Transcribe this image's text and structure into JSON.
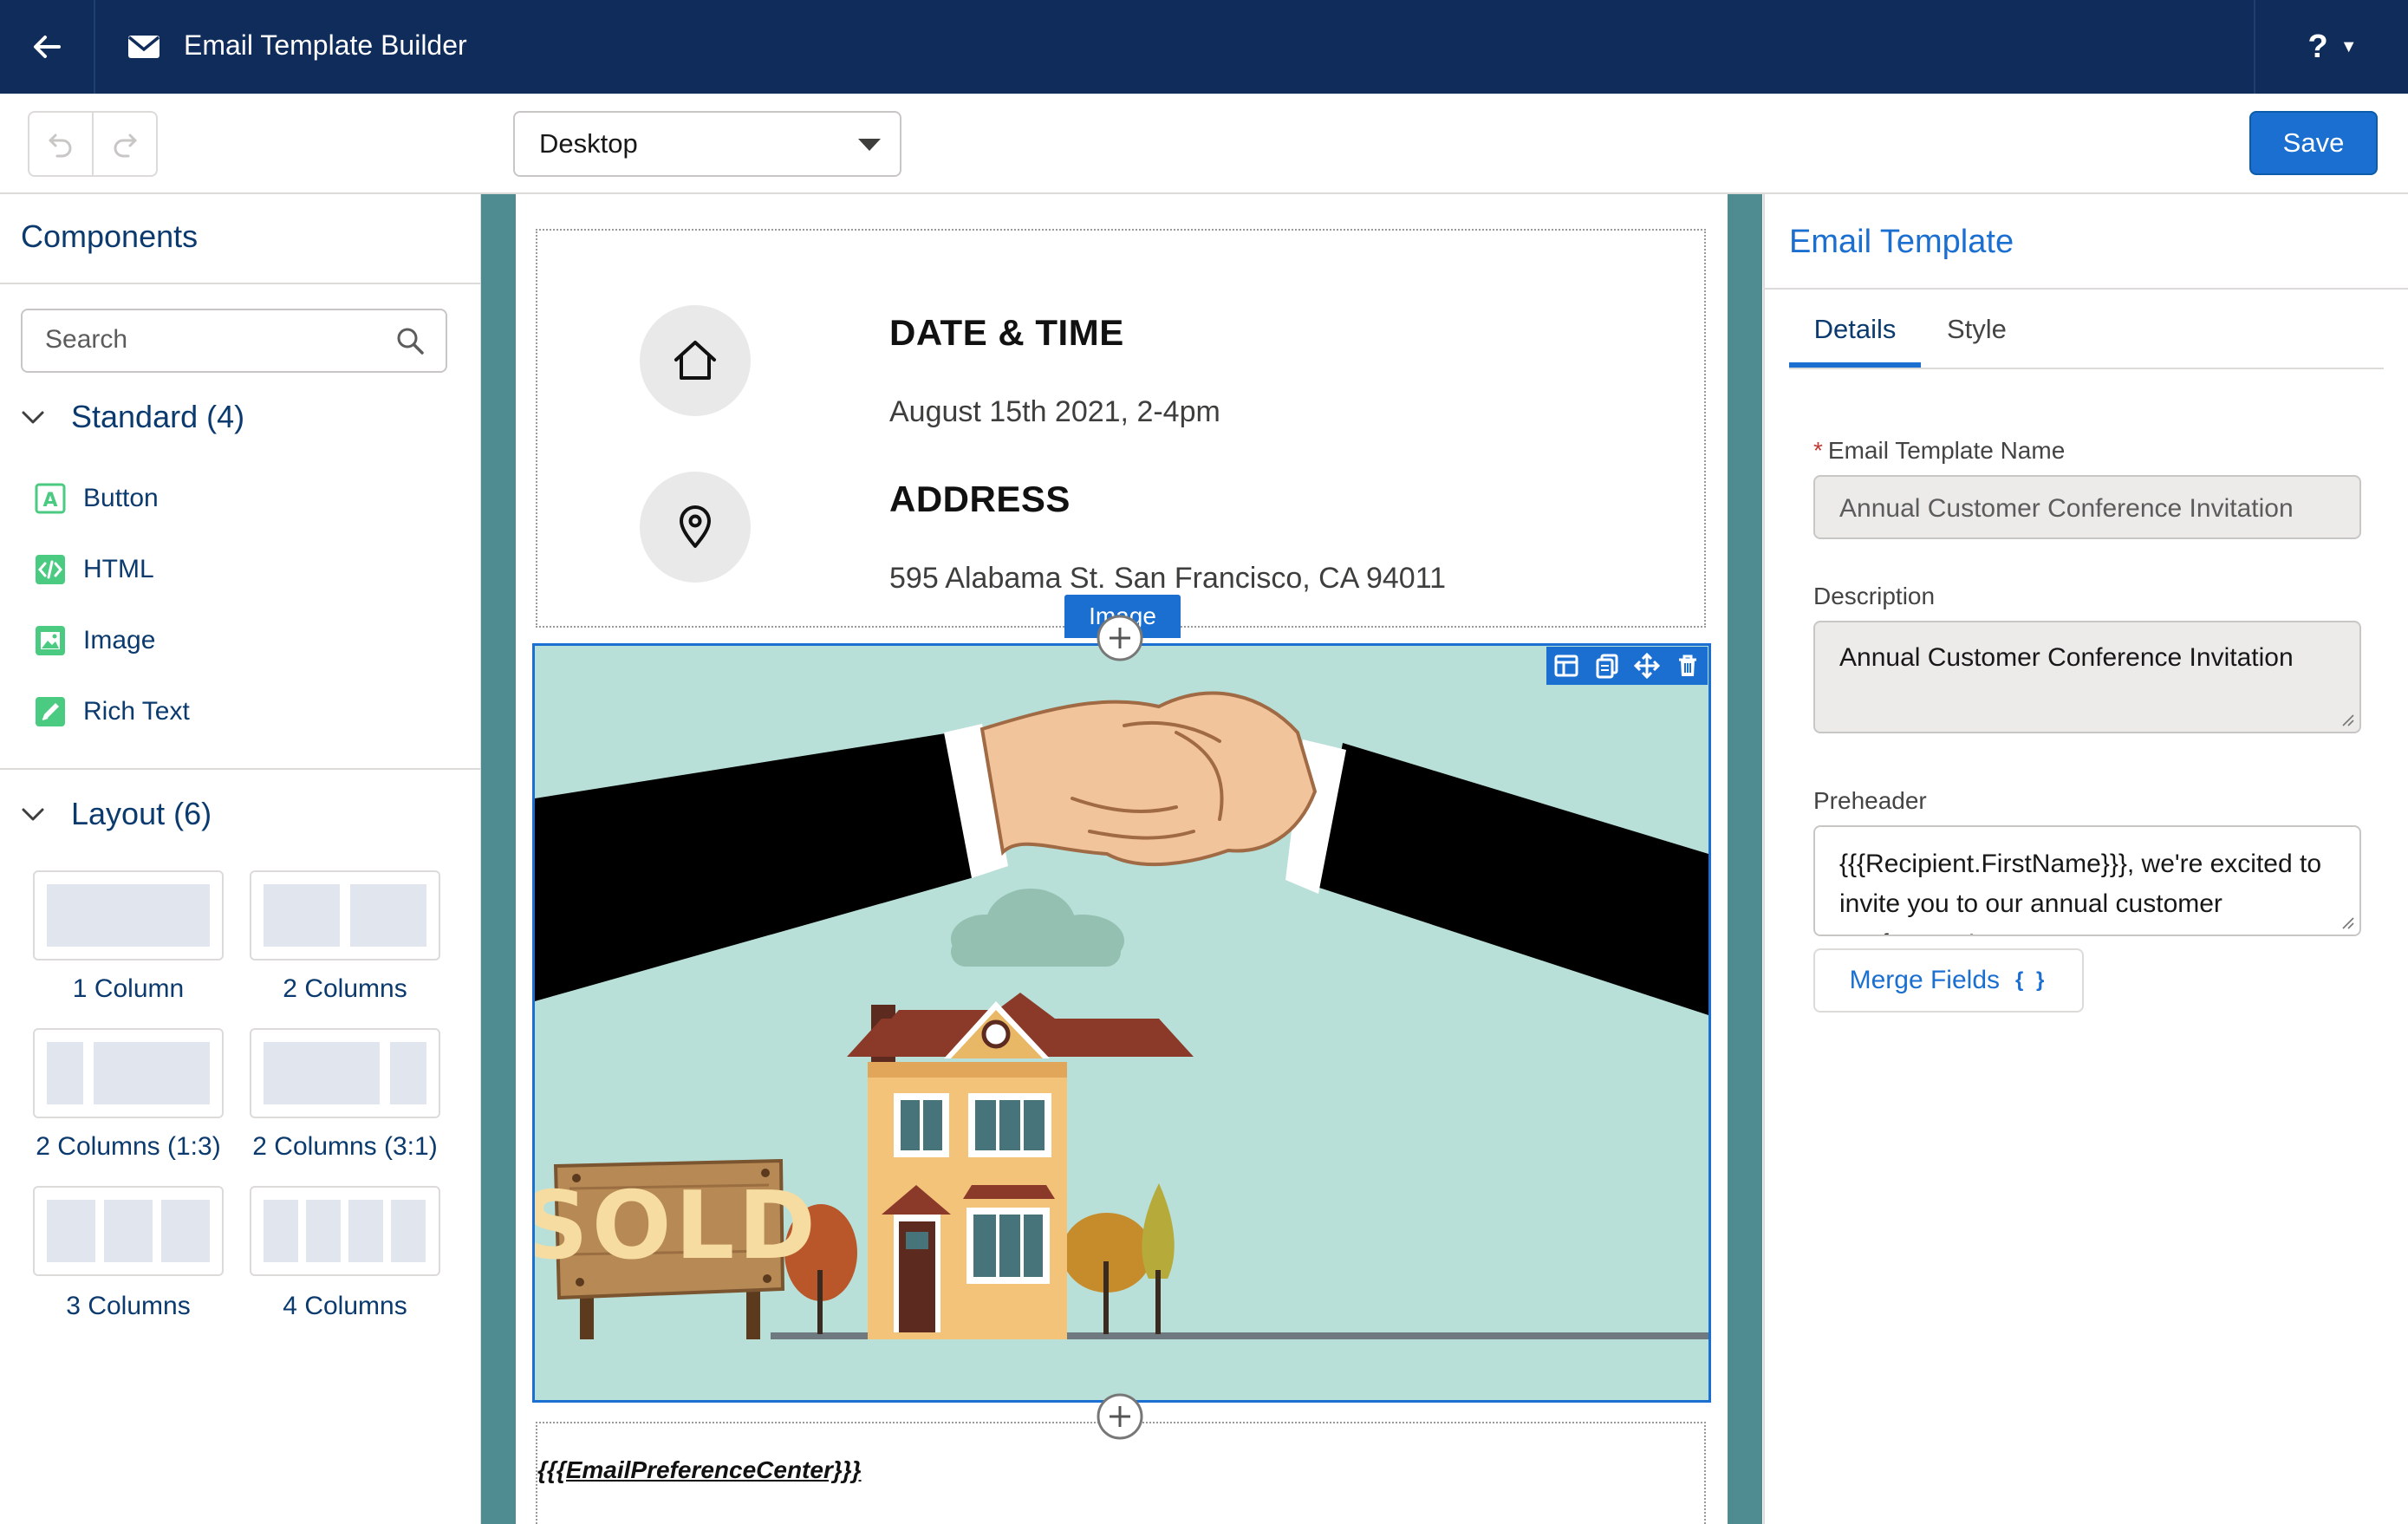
{
  "app": {
    "title": "Email Template Builder"
  },
  "toolbar": {
    "device_value": "Desktop",
    "save_label": "Save"
  },
  "left": {
    "components_title": "Components",
    "search_placeholder": "Search",
    "standard_title": "Standard (4)",
    "standard_items": [
      {
        "label": "Button",
        "icon": "button-component-icon"
      },
      {
        "label": "HTML",
        "icon": "html-component-icon"
      },
      {
        "label": "Image",
        "icon": "image-component-icon"
      },
      {
        "label": "Rich Text",
        "icon": "rich-text-component-icon"
      }
    ],
    "layout_title": "Layout (6)",
    "layout_items": [
      {
        "label": "1 Column"
      },
      {
        "label": "2 Columns"
      },
      {
        "label": "2 Columns (1:3)"
      },
      {
        "label": "2 Columns (3:1)"
      },
      {
        "label": "3 Columns"
      },
      {
        "label": "4 Columns"
      }
    ]
  },
  "canvas": {
    "date_heading": "DATE & TIME",
    "date_text": "August 15th 2021, 2-4pm",
    "address_heading": "ADDRESS",
    "address_text": "595 Alabama St. San Francisco, CA 94011",
    "image_tag": "Image",
    "sign_text": "SOLD",
    "footer_link": "{{{EmailPreferenceCenter}}}"
  },
  "right": {
    "title": "Email Template",
    "tabs": [
      {
        "label": "Details"
      },
      {
        "label": "Style"
      }
    ],
    "name_label": "Email Template Name",
    "name_value": "Annual Customer Conference Invitation",
    "description_label": "Description",
    "description_value": "Annual Customer Conference Invitation",
    "preheader_label": "Preheader",
    "preheader_value": "{{{Recipient.FirstName}}}, we're excited to invite you to our annual customer conference!",
    "merge_fields_label": "Merge Fields",
    "merge_fields_braces": "{ }"
  },
  "colors": {
    "nav": "#0f2c5a",
    "brand": "#1b6fd0",
    "canvas_bg": "#5a9aa0",
    "image_bg": "#b9e0d8"
  }
}
